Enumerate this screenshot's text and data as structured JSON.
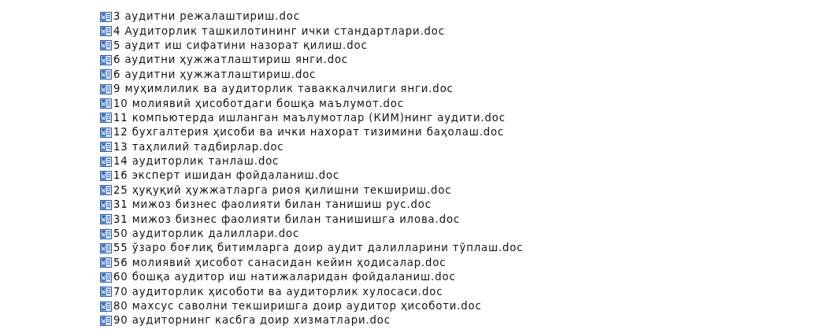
{
  "files": [
    {
      "name": "3 аудитни режалаштириш.doc"
    },
    {
      "name": "4 Аудиторлик ташкилотининг ички стандартлари.doc"
    },
    {
      "name": "5 аудит иш сифатини назорат қилиш.doc"
    },
    {
      "name": "6 аудитни ҳужжатлаштириш янги.doc"
    },
    {
      "name": "6 аудитни ҳужжатлаштириш.doc"
    },
    {
      "name": "9 муҳимлилик ва аудиторлик таваккалчилиги янги.doc"
    },
    {
      "name": "10 молиявий ҳисоботдаги бошқа маълумот.doc"
    },
    {
      "name": "11 компьютерда ишланган маълумотлар (КИМ)нинг аудити.doc"
    },
    {
      "name": "12 бухгалтерия ҳисоби ва ички нахорат тизимини баҳолаш.doc"
    },
    {
      "name": "13 таҳлилий тадбирлар.doc"
    },
    {
      "name": "14 аудиторлик танлаш.doc"
    },
    {
      "name": "16 эксперт ишидан фойдаланиш.doc"
    },
    {
      "name": "25 ҳуқуқий ҳужжатларга риоя қилишни текшириш.doc"
    },
    {
      "name": "31 мижоз бизнес фаолияти билан танишиш рус.doc"
    },
    {
      "name": "31 мижоз бизнес фаолияти билан танишишга илова.doc"
    },
    {
      "name": "50 аудиторлик далиллари.doc"
    },
    {
      "name": "55 ўзаро боғлиқ битимларга доир аудит далилларини тўплаш.doc"
    },
    {
      "name": "56 молиявий ҳисобот санасидан кейин ҳодисалар.doc"
    },
    {
      "name": "60 бошқа аудитор иш натижаларидан фойдаланиш.doc"
    },
    {
      "name": "70 аудиторлик ҳисоботи ва аудиторлик хулосаси.doc"
    },
    {
      "name": "80 махсус саволни текширишга доир аудитор ҳисоботи.doc"
    },
    {
      "name": "90 аудиторнинг касбга доир хизматлари.doc"
    }
  ]
}
